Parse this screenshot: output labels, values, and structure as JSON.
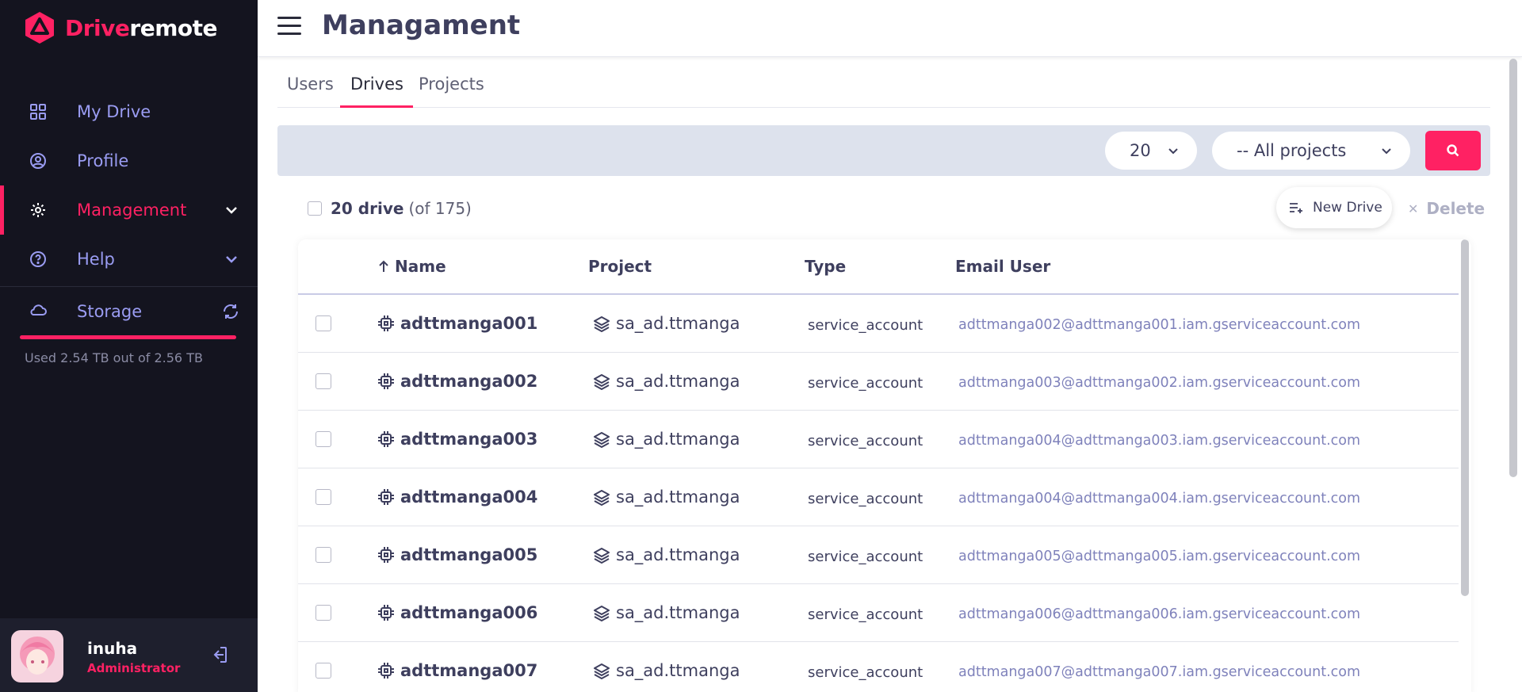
{
  "brand": {
    "part1": "Drive",
    "part2": "remote",
    "accent": "#ff2163"
  },
  "sidebar": {
    "items": [
      {
        "label": "My Drive",
        "icon": "grid-icon"
      },
      {
        "label": "Profile",
        "icon": "user-circle-icon"
      },
      {
        "label": "Management",
        "icon": "gear-icon",
        "active": true
      },
      {
        "label": "Help",
        "icon": "help-icon"
      }
    ],
    "storage": {
      "label": "Storage",
      "usage_text": "Used 2.54 TB out of 2.56 TB",
      "used_fraction": 0.992
    },
    "user": {
      "name": "inuha",
      "role": "Administrator"
    }
  },
  "header": {
    "title": "Managament"
  },
  "tabs": [
    "Users",
    "Drives",
    "Projects"
  ],
  "active_tab": "Drives",
  "filters": {
    "page_size": "20",
    "project": "-- All projects"
  },
  "summary": {
    "count": "20 drive",
    "total": "(of 175)"
  },
  "actions": {
    "new_drive": "New Drive",
    "delete": "Delete"
  },
  "table": {
    "columns": [
      "Name",
      "Project",
      "Type",
      "Email User"
    ],
    "rows": [
      {
        "name": "adttmanga001",
        "project": "sa_ad.ttmanga",
        "type": "service_account",
        "email": "adttmanga002@adttmanga001.iam.gserviceaccount.com"
      },
      {
        "name": "adttmanga002",
        "project": "sa_ad.ttmanga",
        "type": "service_account",
        "email": "adttmanga003@adttmanga002.iam.gserviceaccount.com"
      },
      {
        "name": "adttmanga003",
        "project": "sa_ad.ttmanga",
        "type": "service_account",
        "email": "adttmanga004@adttmanga003.iam.gserviceaccount.com"
      },
      {
        "name": "adttmanga004",
        "project": "sa_ad.ttmanga",
        "type": "service_account",
        "email": "adttmanga004@adttmanga004.iam.gserviceaccount.com"
      },
      {
        "name": "adttmanga005",
        "project": "sa_ad.ttmanga",
        "type": "service_account",
        "email": "adttmanga005@adttmanga005.iam.gserviceaccount.com"
      },
      {
        "name": "adttmanga006",
        "project": "sa_ad.ttmanga",
        "type": "service_account",
        "email": "adttmanga006@adttmanga006.iam.gserviceaccount.com"
      },
      {
        "name": "adttmanga007",
        "project": "sa_ad.ttmanga",
        "type": "service_account",
        "email": "adttmanga007@adttmanga007.iam.gserviceaccount.com"
      }
    ]
  }
}
